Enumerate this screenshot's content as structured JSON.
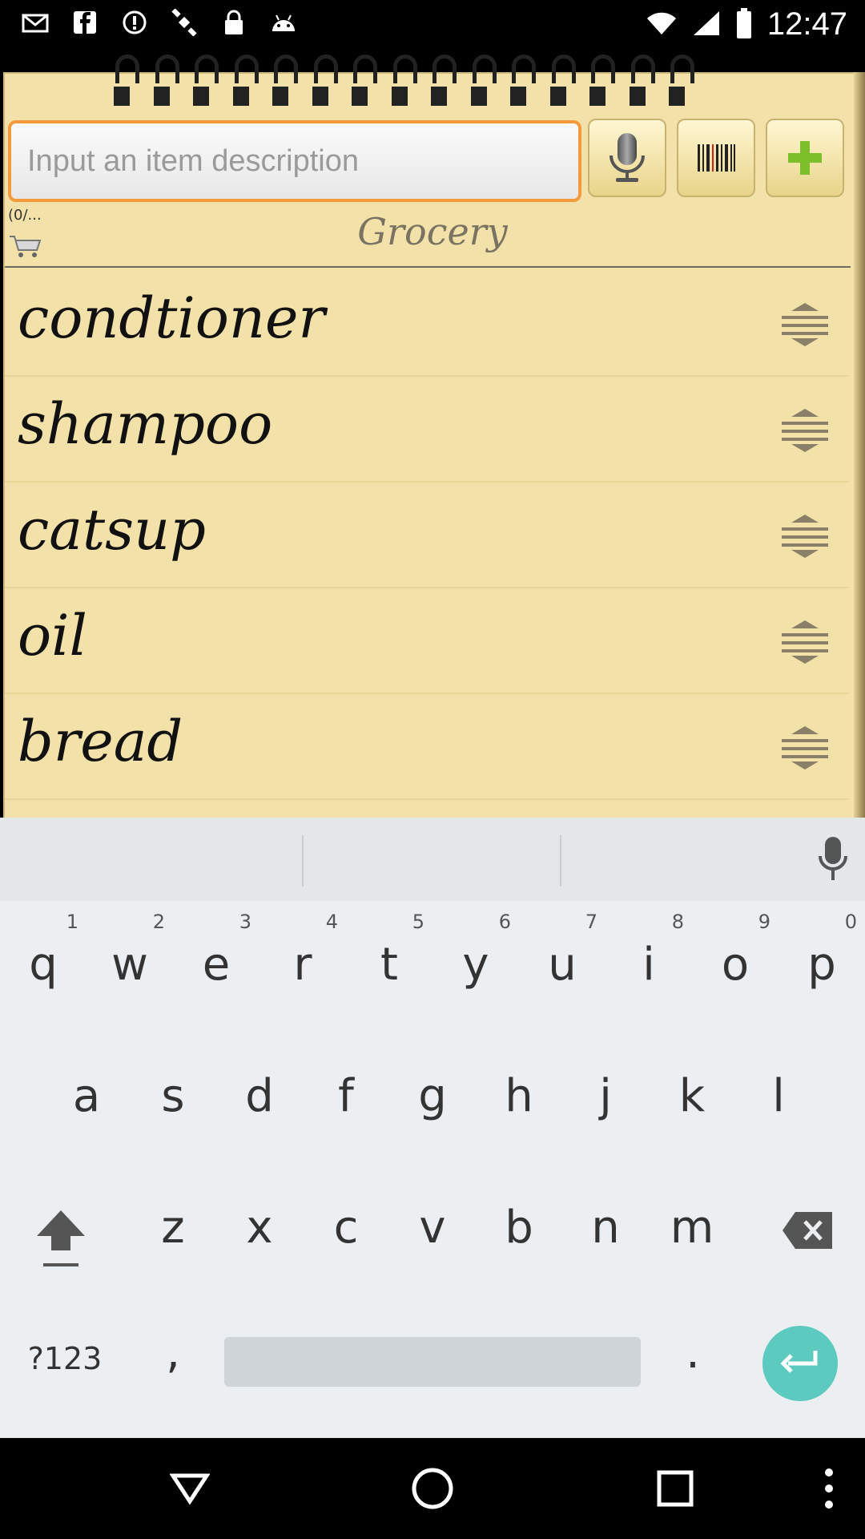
{
  "status_bar": {
    "time": "12:47",
    "left_icons": [
      "mail-icon",
      "facebook-icon",
      "alert-icon",
      "satellite-icon",
      "lock-icon",
      "android-icon"
    ],
    "right_icons": [
      "wifi-icon",
      "signal-icon",
      "battery-icon"
    ]
  },
  "header": {
    "input_placeholder": "Input an item description",
    "count_text": "(0/...",
    "list_title": "Grocery",
    "buttons": [
      "mic-icon",
      "barcode-icon",
      "plus-icon"
    ]
  },
  "items": [
    {
      "label": "condtioner"
    },
    {
      "label": "shampoo"
    },
    {
      "label": "catsup"
    },
    {
      "label": "oil"
    },
    {
      "label": "bread"
    }
  ],
  "keyboard": {
    "row1": [
      "q",
      "w",
      "e",
      "r",
      "t",
      "y",
      "u",
      "i",
      "o",
      "p"
    ],
    "row1_hints": [
      "1",
      "2",
      "3",
      "4",
      "5",
      "6",
      "7",
      "8",
      "9",
      "0"
    ],
    "row2": [
      "a",
      "s",
      "d",
      "f",
      "g",
      "h",
      "j",
      "k",
      "l"
    ],
    "row3": [
      "z",
      "x",
      "c",
      "v",
      "b",
      "n",
      "m"
    ],
    "symbols_label": "?123",
    "comma": ",",
    "period": "."
  },
  "colors": {
    "paper": "#f2e1a8",
    "input_border": "#f59a3c",
    "enter": "#5ccabf",
    "plus": "#7cbf2a"
  }
}
